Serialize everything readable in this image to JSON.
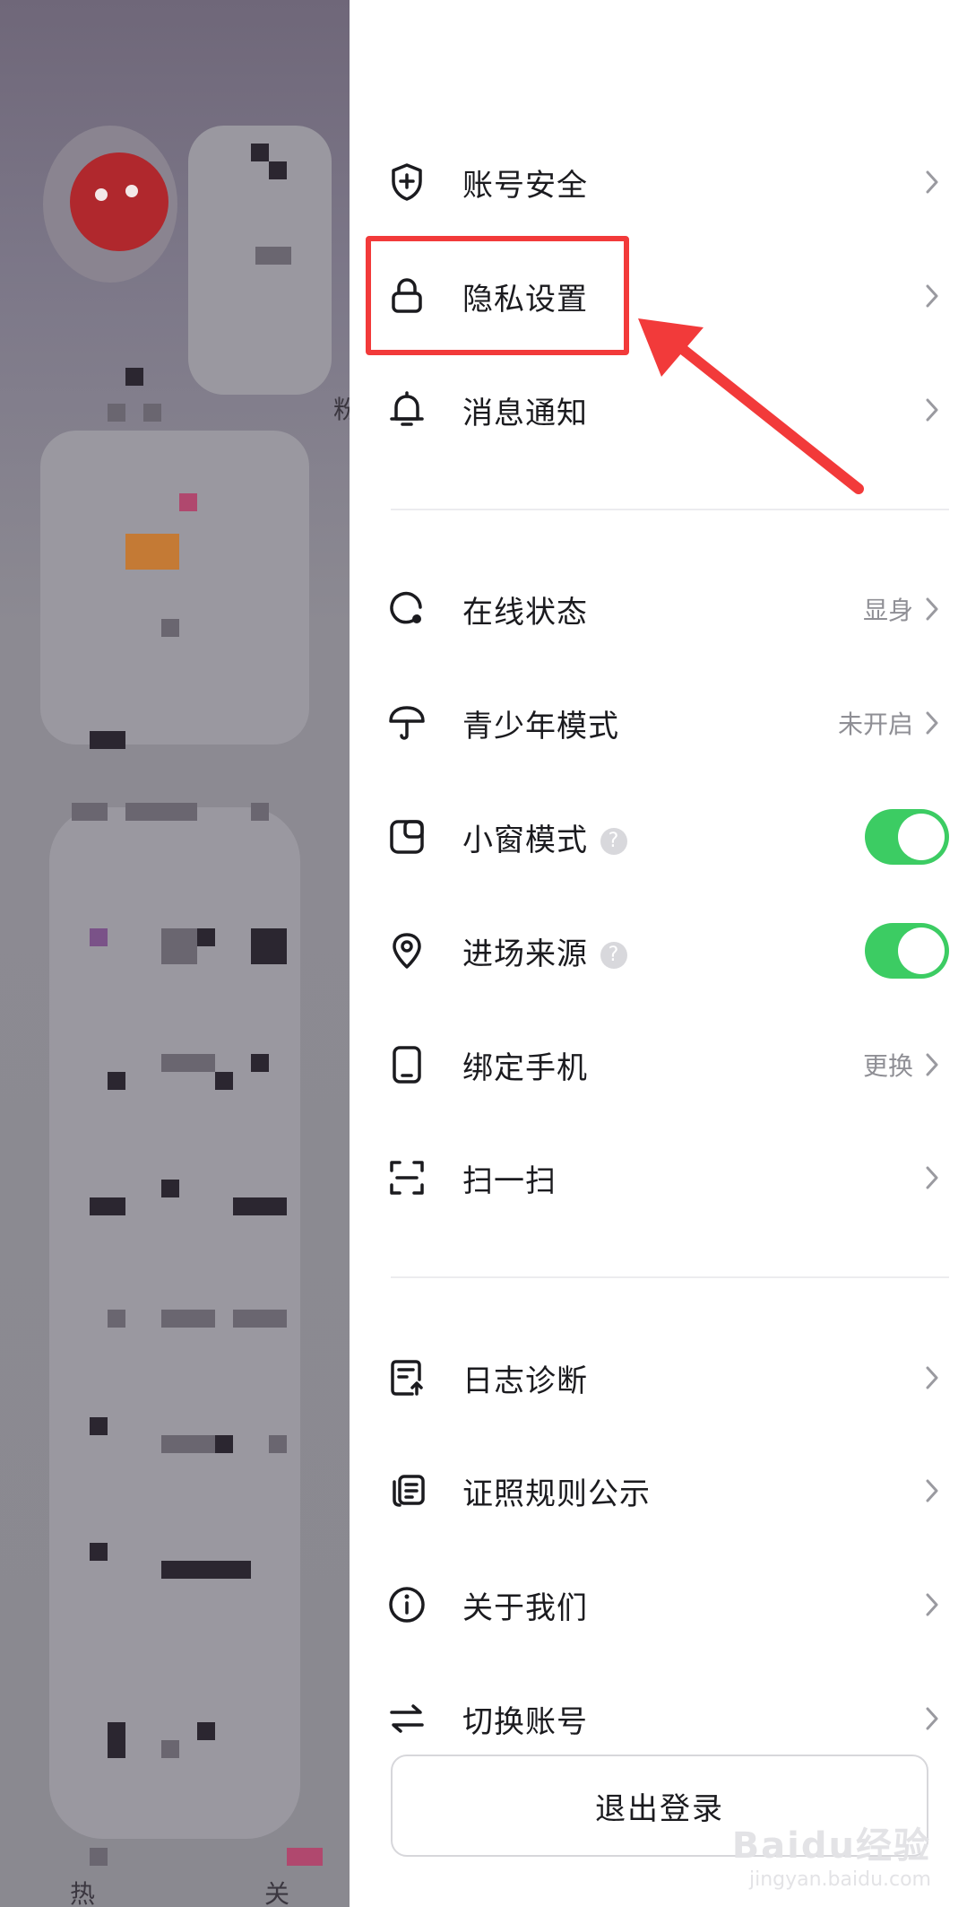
{
  "settings": {
    "items": [
      {
        "label": "账号安全",
        "icon": "shield-plus-icon"
      },
      {
        "label": "隐私设置",
        "icon": "lock-icon"
      },
      {
        "label": "消息通知",
        "icon": "bell-icon"
      },
      {
        "label": "在线状态",
        "icon": "online-status-icon",
        "value": "显身"
      },
      {
        "label": "青少年模式",
        "icon": "umbrella-icon",
        "value": "未开启"
      },
      {
        "label": "小窗模式",
        "icon": "mini-window-icon",
        "toggle": true
      },
      {
        "label": "进场来源",
        "icon": "location-pin-icon",
        "toggle": true
      },
      {
        "label": "绑定手机",
        "icon": "phone-icon",
        "value": "更换"
      },
      {
        "label": "扫一扫",
        "icon": "scan-icon"
      },
      {
        "label": "日志诊断",
        "icon": "log-upload-icon"
      },
      {
        "label": "证照规则公示",
        "icon": "license-icon"
      },
      {
        "label": "关于我们",
        "icon": "info-icon"
      },
      {
        "label": "切换账号",
        "icon": "switch-icon"
      }
    ],
    "help_glyph": "?",
    "logout_label": "退出登录"
  },
  "background": {
    "partial_text": [
      "粉",
      "热",
      "关"
    ]
  },
  "watermark": {
    "main": "Baidu经验",
    "sub": "jingyan.baidu.com"
  },
  "colors": {
    "accent_toggle": "#3ccc63",
    "annotation_red": "#f23a3a"
  }
}
